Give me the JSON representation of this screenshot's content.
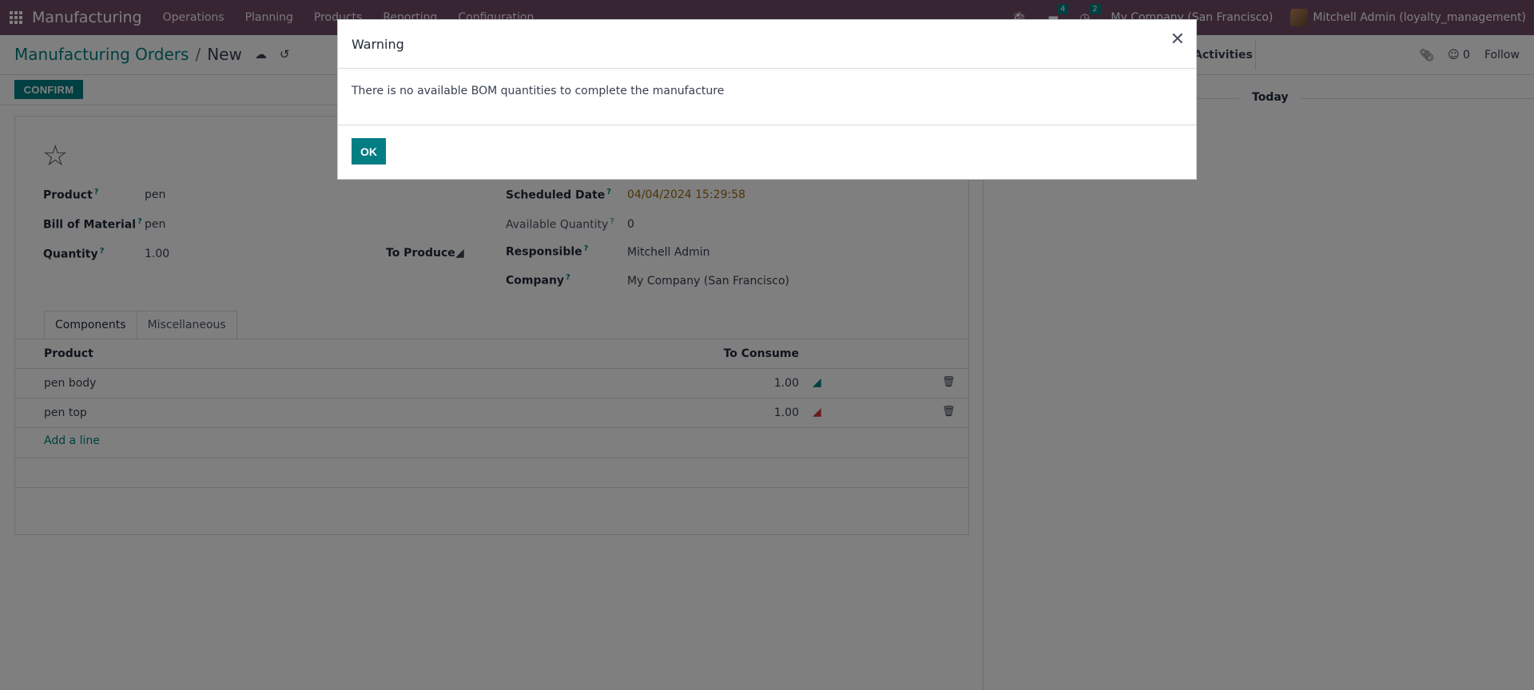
{
  "navbar": {
    "app_name": "Manufacturing",
    "menu": [
      "Operations",
      "Planning",
      "Products",
      "Reporting",
      "Configuration"
    ],
    "bug_icon": "bug-icon",
    "messages_count": "4",
    "activities_count": "2",
    "company": "My Company (San Francisco)",
    "user": "Mitchell Admin (loyalty_management)"
  },
  "control": {
    "breadcrumb_parent": "Manufacturing Orders",
    "breadcrumb_sep": "/",
    "breadcrumb_current": "New",
    "activities_label": "Activities",
    "followers_count": "0",
    "follow_label": "Follow"
  },
  "status": {
    "confirm_label": "CONFIRM"
  },
  "form": {
    "product_label": "Product",
    "product_value": "pen",
    "bom_label": "Bill of Material",
    "bom_value": "pen",
    "quantity_label": "Quantity",
    "quantity_value": "1.00",
    "to_produce_label": "To Produce",
    "scheduled_date_label": "Scheduled Date",
    "scheduled_date_value": "04/04/2024 15:29:58",
    "available_qty_label": "Available Quantity",
    "available_qty_value": "0",
    "responsible_label": "Responsible",
    "responsible_value": "Mitchell Admin",
    "company_label": "Company",
    "company_value": "My Company (San Francisco)",
    "help_mark": "?"
  },
  "tabs": [
    "Components",
    "Miscellaneous"
  ],
  "components": {
    "columns": [
      "Product",
      "To Consume"
    ],
    "rows": [
      {
        "product": "pen body",
        "qty": "1.00",
        "forecast_color": "#017e84"
      },
      {
        "product": "pen top",
        "qty": "1.00",
        "forecast_color": "#d23f3a"
      }
    ],
    "add_line": "Add a line"
  },
  "chatter": {
    "today_label": "Today"
  },
  "modal": {
    "title": "Warning",
    "message": "There is no available BOM quantities to complete the manufacture",
    "ok_label": "OK"
  }
}
